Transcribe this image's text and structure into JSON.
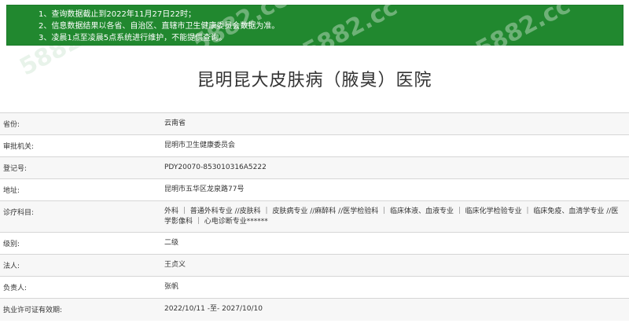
{
  "notice": {
    "lines": [
      "1、查询数据截止到2022年11月27日22时；",
      "2、信息数据结果以各省、自治区、直辖市卫生健康委员会数据为准。",
      "3、凌晨1点至凌晨5点系统进行维护，不能提供查询。"
    ]
  },
  "title": "昆明昆大皮肤病（腋臭）医院",
  "rows": [
    {
      "label": "省份:",
      "value": "云南省"
    },
    {
      "label": "审批机关:",
      "value": "昆明市卫生健康委员会"
    },
    {
      "label": "登记号:",
      "value": "PDY20070-853010316A5222"
    },
    {
      "label": "地址:",
      "value": "昆明市五华区龙泉路77号"
    },
    {
      "label": "诊疗科目:",
      "value": "外科 ｜ 普通外科专业 //皮肤科 ｜ 皮肤病专业 //麻醉科 //医学检验科 ｜ 临床体液、血液专业 ｜ 临床化学检验专业 ｜ 临床免疫、血清学专业 //医学影像科 ｜ 心电诊断专业******"
    },
    {
      "label": "级别:",
      "value": "二级"
    },
    {
      "label": "法人:",
      "value": "王贞义"
    },
    {
      "label": "负责人:",
      "value": "张帆"
    },
    {
      "label": "执业许可证有效期:",
      "value": "2022/10/11 -至- 2027/10/10"
    }
  ],
  "watermark": "5882.cc"
}
